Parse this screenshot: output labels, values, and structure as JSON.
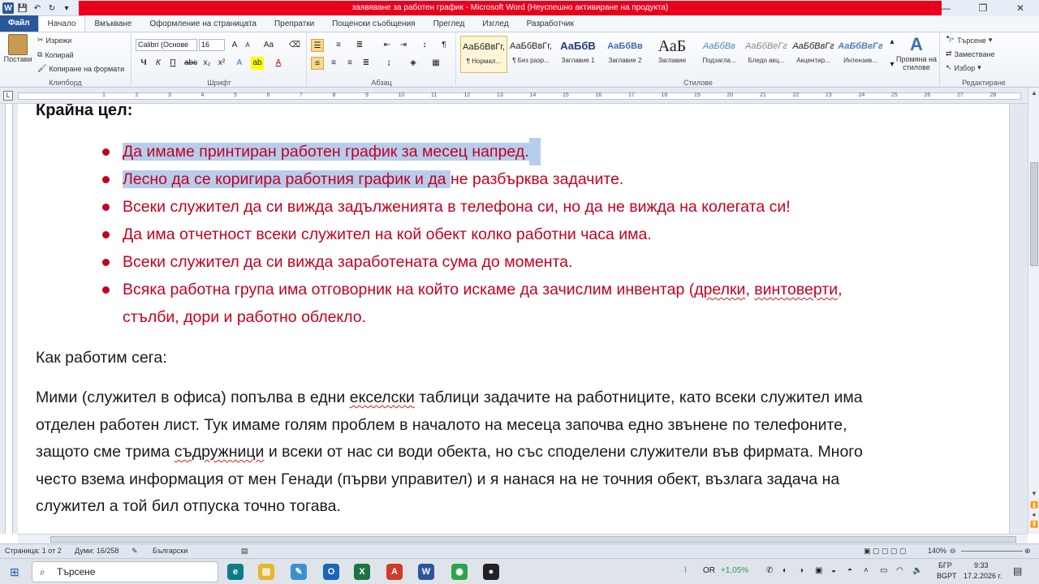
{
  "window": {
    "title": "заявяване за работен график - Microsoft Word (Неуспешно активиране на продукта)",
    "min": "—",
    "max": "❐",
    "close": "✕"
  },
  "ribbon_tabs": [
    "Файл",
    "Начало",
    "Вмъкване",
    "Оформление на страницата",
    "Препратки",
    "Пощенски съобщения",
    "Преглед",
    "Изглед",
    "Разработчик"
  ],
  "clipboard": {
    "paste": "Постави",
    "cut": "Изрежи",
    "copy": "Копирай",
    "format_painter": "Копиране на формати",
    "label": "Клипборд"
  },
  "font": {
    "name": "Calibri (Основе",
    "size": "16",
    "label": "Шрифт",
    "bold": "Ч",
    "italic": "К",
    "underline": "П"
  },
  "paragraph": {
    "label": "Абзац"
  },
  "styles": {
    "label": "Стилове",
    "items": [
      {
        "sample": "АаБбВвГг,",
        "name": "¶ Нормал..."
      },
      {
        "sample": "АаБбВвГг,",
        "name": "¶ Без разр..."
      },
      {
        "sample": "АаБбВ",
        "name": "Заглавие 1"
      },
      {
        "sample": "АаБбВв",
        "name": "Заглавие 2"
      },
      {
        "sample": "АаБ",
        "name": "Заглавие"
      },
      {
        "sample": "АаБбВв",
        "name": "Подзагла..."
      },
      {
        "sample": "АаБбВеГг",
        "name": "Бледо акц..."
      },
      {
        "sample": "АаБбВвГг",
        "name": "Акцентир..."
      },
      {
        "sample": "АаБбВеГг",
        "name": "Интензив..."
      }
    ],
    "change": "Промяна на стилове"
  },
  "editing": {
    "find": "Търсене",
    "replace": "Заместване",
    "select": "Избор",
    "label": "Редактиране"
  },
  "ruler_numbers": [
    "1",
    "2",
    "3",
    "4",
    "5",
    "6",
    "7",
    "8",
    "9",
    "10",
    "11",
    "12",
    "13",
    "14",
    "15",
    "16",
    "17",
    "18",
    "19",
    "20",
    "21",
    "22",
    "23",
    "24",
    "25",
    "26",
    "27",
    "28"
  ],
  "document": {
    "heading": "Крайна цел:",
    "bullets": [
      {
        "pre_hl": "",
        "hl": "Да имаме принтиран работен график за месец напред.",
        "post": ""
      },
      {
        "pre_hl": "",
        "hl": "Лесно да се коригира работния график и да ",
        "post": "не разбърква задачите."
      },
      {
        "pre_hl": "",
        "hl": "",
        "post": "Всеки служител да си вижда задълженията в телефона си, но да не вижда на колегата си!"
      },
      {
        "pre_hl": "",
        "hl": "",
        "post": "Да има отчетност всеки служител на кой обект колко работни часа има."
      },
      {
        "pre_hl": "",
        "hl": "",
        "post": "Всеки служител да си вижда заработената сума до момента."
      }
    ],
    "bullet6": {
      "a": "Всяка работна група има отговорник на който искаме да зачислим инвентар (",
      "b": "дрелки",
      "c": ", ",
      "d": "винтоверти",
      "e": ",",
      "f": "стълби, дори и работно облекло."
    },
    "how_now": "Как работим сега:",
    "para": {
      "l1a": "Мими (служител в офиса) попълва в едни ",
      "l1b": "екселски",
      "l1c": " таблици задачите на работниците, като всеки служител има",
      "l2": "отделен работен лист. Тук имаме голям проблем в началото на месеца започва едно звънене по телефоните,",
      "l3a": "защото сме трима ",
      "l3b": "съдружници",
      "l3c": " и всеки от нас си води обекта, но със споделени служители във фирмата. Много",
      "l4": "често взема информация от мен Генади (първи управител) и я нанася на не точния обект, възлага задача на",
      "l5": "служител а той бил отпуска точно тогава."
    }
  },
  "status": {
    "page": "Страница: 1 от 2",
    "words": "Думи: 16/258",
    "language": "Български",
    "zoom": "140%"
  },
  "taskbar": {
    "search": "Търсене",
    "ticker": "OR",
    "ticker_change": "+1,05%",
    "lang1": "БГР",
    "lang2": "BGPT",
    "time": "9:33",
    "date": "17.2.2026 г."
  }
}
